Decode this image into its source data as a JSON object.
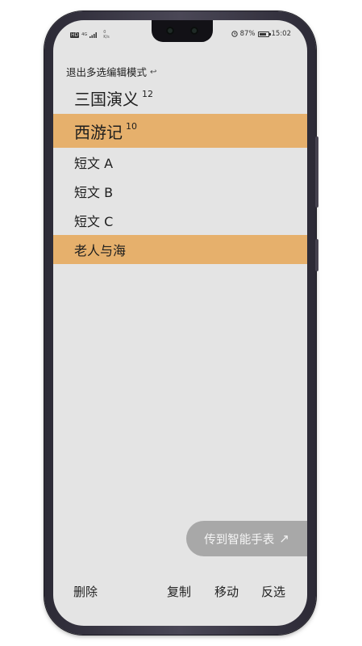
{
  "status_bar": {
    "hd": "HD",
    "signal": "4G",
    "speed_value": "0",
    "speed_unit": "K/s",
    "battery_percent": "87%",
    "battery_level": 0.87,
    "time": "15:02"
  },
  "header": {
    "exit_label": "退出多选编辑模式",
    "exit_icon": "return-arrow-icon"
  },
  "list": {
    "items": [
      {
        "label": "三国演义",
        "count": "12",
        "selected": false
      },
      {
        "label": "西游记",
        "count": "10",
        "selected": true
      },
      {
        "label": "短文 A",
        "count": "",
        "selected": false
      },
      {
        "label": "短文 B",
        "count": "",
        "selected": false
      },
      {
        "label": "短文 C",
        "count": "",
        "selected": false
      },
      {
        "label": "老人与海",
        "count": "",
        "selected": true
      }
    ]
  },
  "sync_button": {
    "label": "传到智能手表",
    "icon": "arrow-up-right-icon"
  },
  "actions": {
    "delete": "删除",
    "copy": "复制",
    "move": "移动",
    "invert": "反选"
  },
  "colors": {
    "selected_row": "#e6b06c",
    "screen_bg": "#e4e4e4",
    "sync_bg": "#a8a8a8"
  }
}
